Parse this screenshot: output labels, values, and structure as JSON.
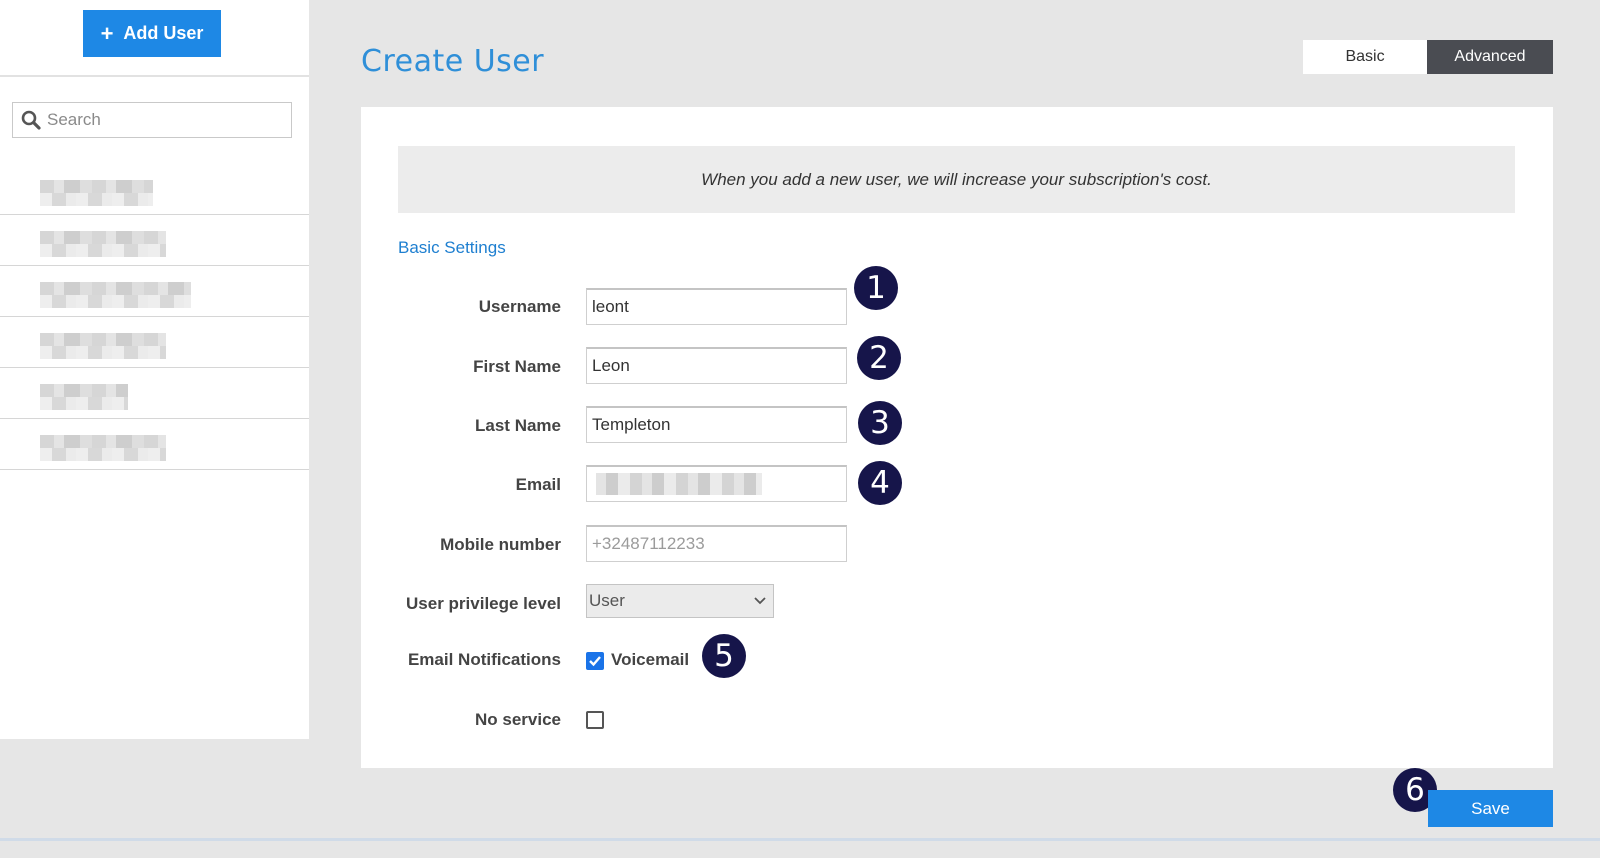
{
  "sidebar": {
    "add_user_icon": "plus-icon",
    "add_user_label": "Add User",
    "search": {
      "placeholder": "Search",
      "icon": "search-icon"
    },
    "users": [
      {
        "blurred": true
      },
      {
        "blurred": true
      },
      {
        "blurred": true
      },
      {
        "blurred": true
      },
      {
        "blurred": true
      },
      {
        "blurred": true
      }
    ]
  },
  "header": {
    "title": "Create User",
    "view_tabs": {
      "basic": "Basic",
      "advanced": "Advanced",
      "active": "Advanced"
    }
  },
  "form": {
    "notice": "When you add a new user, we will increase your subscription's cost.",
    "section_title": "Basic Settings",
    "username": {
      "label": "Username",
      "value": "leont"
    },
    "first_name": {
      "label": "First Name",
      "value": "Leon"
    },
    "last_name": {
      "label": "Last Name",
      "value": "Templeton"
    },
    "email": {
      "label": "Email",
      "value": "",
      "blurred": true
    },
    "mobile": {
      "label": "Mobile number",
      "value": "",
      "placeholder": "+32487112233"
    },
    "privilege": {
      "label": "User privilege level",
      "value": "User",
      "icon": "chevron-down-icon"
    },
    "email_notifications": {
      "label": "Email Notifications",
      "option": "Voicemail",
      "checked": true
    },
    "no_service": {
      "label": "No service",
      "checked": false
    }
  },
  "actions": {
    "save_label": "Save"
  },
  "annotations": [
    "1",
    "2",
    "3",
    "4",
    "5",
    "6"
  ],
  "colors": {
    "accent": "#1e88e5",
    "title": "#2f8fd8",
    "badge": "#16154a",
    "advanced_tab": "#4a4c52"
  }
}
